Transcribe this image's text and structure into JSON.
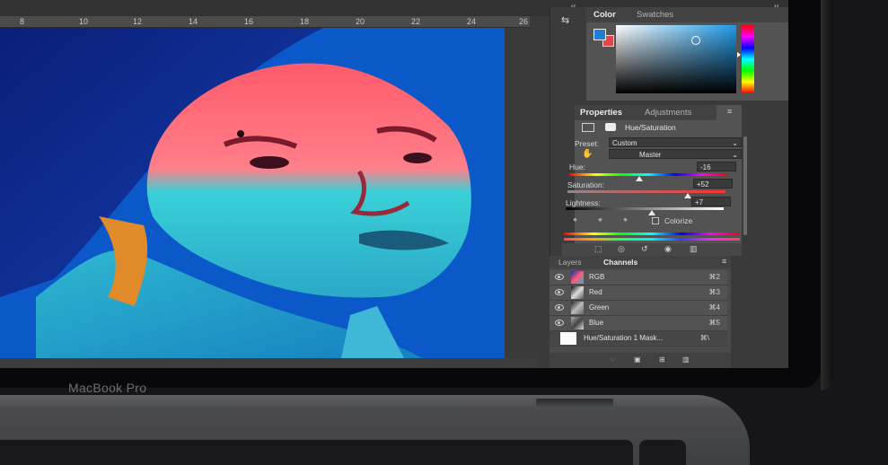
{
  "device": {
    "label": "MacBook Pro"
  },
  "ruler": {
    "ticks": [
      "8",
      "10",
      "12",
      "14",
      "16",
      "18",
      "20",
      "22",
      "24",
      "26"
    ]
  },
  "color_panel": {
    "tabs": [
      "Color",
      "Swatches"
    ],
    "foreground": "#1d7fd9",
    "background": "#e0464a"
  },
  "properties_panel": {
    "tabs": [
      "Properties",
      "Adjustments"
    ],
    "title": "Hue/Saturation",
    "preset_label": "Preset:",
    "preset_value": "Custom",
    "channel_value": "Master",
    "hue_label": "Hue:",
    "hue_value": "-16",
    "saturation_label": "Saturation:",
    "saturation_value": "+52",
    "lightness_label": "Lightness:",
    "lightness_value": "+7",
    "colorize_label": "Colorize"
  },
  "channels_panel": {
    "tabs": [
      "Layers",
      "Channels"
    ],
    "rows": [
      {
        "name": "RGB",
        "shortcut": "⌘2"
      },
      {
        "name": "Red",
        "shortcut": "⌘3"
      },
      {
        "name": "Green",
        "shortcut": "⌘4"
      },
      {
        "name": "Blue",
        "shortcut": "⌘5"
      },
      {
        "name": "Hue/Saturation 1 Mask...",
        "shortcut": "⌘\\"
      }
    ]
  }
}
